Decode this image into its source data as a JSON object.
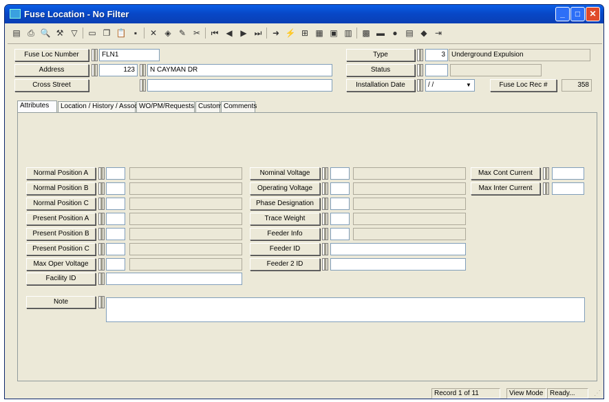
{
  "window": {
    "title": "Fuse Location - No Filter"
  },
  "toolbar": {
    "icons": [
      "list-icon",
      "print-icon",
      "preview-icon",
      "tools-icon",
      "filter-icon",
      "new-record-icon",
      "copy-icon",
      "paste-icon",
      "save-icon",
      "delete-icon",
      "stack-icon",
      "edit-icon",
      "cut-icon",
      "first-icon",
      "prev-icon",
      "next-icon",
      "last-icon",
      "goto-icon",
      "flash-icon",
      "tree-icon",
      "grid-icon",
      "report-icon",
      "chart-icon",
      "map-icon",
      "car-icon",
      "globe-icon",
      "table-icon",
      "book-icon",
      "exit-icon"
    ]
  },
  "header": {
    "fuse_loc_number": {
      "label": "Fuse Loc Number",
      "value": "FLN1"
    },
    "address": {
      "label": "Address",
      "number": "123",
      "street": "N CAYMAN DR"
    },
    "cross_street": {
      "label": "Cross Street",
      "value": ""
    },
    "type": {
      "label": "Type",
      "code": "3",
      "description": "Underground Expulsion"
    },
    "status": {
      "label": "Status",
      "code": "",
      "description": ""
    },
    "installation_date": {
      "label": "Installation Date",
      "value": "/ /"
    },
    "fuse_loc_rec": {
      "label": "Fuse Loc Rec #",
      "value": "358"
    }
  },
  "tabs": [
    {
      "label": "Attributes",
      "active": true
    },
    {
      "label": "Location / History / Assoc",
      "active": false
    },
    {
      "label": "WO/PM/Requests",
      "active": false
    },
    {
      "label": "Custom",
      "active": false
    },
    {
      "label": "Comments",
      "active": false
    }
  ],
  "attributes": {
    "left": [
      {
        "label": "Normal Position A",
        "code": "",
        "desc": ""
      },
      {
        "label": "Normal Position B",
        "code": "",
        "desc": ""
      },
      {
        "label": "Normal Position C",
        "code": "",
        "desc": ""
      },
      {
        "label": "Present Position A",
        "code": "",
        "desc": ""
      },
      {
        "label": "Present Position B",
        "code": "",
        "desc": ""
      },
      {
        "label": "Present Position C",
        "code": "",
        "desc": ""
      },
      {
        "label": "Max Oper Voltage",
        "code": "",
        "desc": ""
      }
    ],
    "facility_id": {
      "label": "Facility ID",
      "value": ""
    },
    "middle": [
      {
        "label": "Nominal Voltage",
        "code": "",
        "desc": ""
      },
      {
        "label": "Operating Voltage",
        "code": "",
        "desc": ""
      },
      {
        "label": "Phase Designation",
        "code": "",
        "desc": ""
      },
      {
        "label": "Trace Weight",
        "code": "",
        "desc": ""
      },
      {
        "label": "Feeder Info",
        "code": "",
        "desc": ""
      }
    ],
    "feeder_id": {
      "label": "Feeder ID",
      "value": ""
    },
    "feeder_2_id": {
      "label": "Feeder 2 ID",
      "value": ""
    },
    "right": [
      {
        "label": "Max Cont Current",
        "value": ""
      },
      {
        "label": "Max Inter Current",
        "value": ""
      }
    ],
    "note": {
      "label": "Note",
      "value": ""
    }
  },
  "status_bar": {
    "record": "Record 1 of 11",
    "mode": "View Mode",
    "state": "Ready..."
  }
}
